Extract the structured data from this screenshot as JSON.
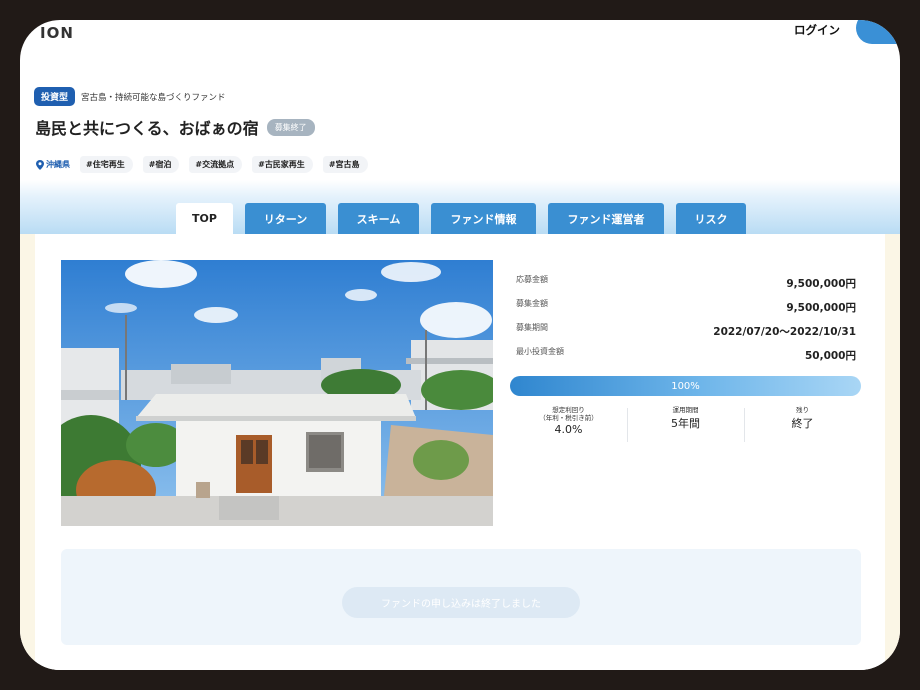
{
  "header": {
    "logo_fragment": "ION",
    "login_label": "ログイン"
  },
  "project": {
    "type_badge": "投資型",
    "fund_name": "宮古島・持続可能な島づくりファンド",
    "title": "島民と共につくる、おばぁの宿",
    "status_badge": "募集終了",
    "location": "沖縄県",
    "tags": [
      "#住宅再生",
      "#宿泊",
      "#交流拠点",
      "#古民家再生",
      "#宮古島"
    ]
  },
  "tabs": [
    "TOP",
    "リターン",
    "スキーム",
    "ファンド情報",
    "ファンド運営者",
    "リスク"
  ],
  "active_tab": "TOP",
  "info": [
    {
      "label": "応募金額",
      "value": "9,500,000円"
    },
    {
      "label": "募集金額",
      "value": "9,500,000円"
    },
    {
      "label": "募集期間",
      "value": "2022/07/20〜2022/10/31"
    },
    {
      "label": "最小投資金額",
      "value": "50,000円"
    }
  ],
  "progress": {
    "label": "100%",
    "fraction": 1.0
  },
  "stats": [
    {
      "label": "想定利回り\n（年利・税引き前）",
      "value": "4.0%"
    },
    {
      "label": "運用期間",
      "value": "5年間"
    },
    {
      "label": "残り",
      "value": "終了"
    }
  ],
  "apply_button": "ファンドの申し込みは終了しました",
  "colors": {
    "accent": "#3a8fd2",
    "badge": "#1f5fb0",
    "panel": "#eef5fb"
  }
}
